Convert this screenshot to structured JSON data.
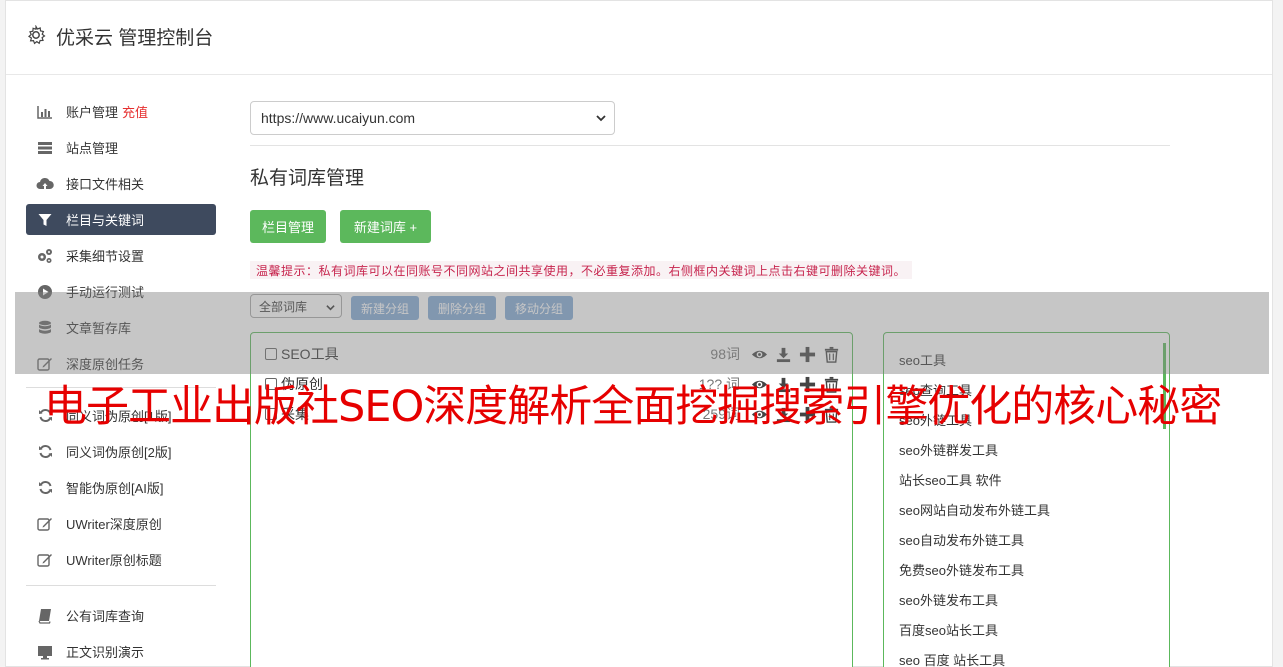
{
  "header": {
    "title": "优采云 管理控制台",
    "icon": "gear-icon"
  },
  "sidebar": {
    "items": [
      {
        "label": "账户管理",
        "badge": "充值",
        "icon": "bar-chart-icon"
      },
      {
        "label": "站点管理",
        "icon": "server-icon"
      },
      {
        "label": "接口文件相关",
        "icon": "cloud-upload-icon"
      },
      {
        "label": "栏目与关键词",
        "icon": "filter-icon",
        "active": true
      },
      {
        "label": "采集细节设置",
        "icon": "cogs-icon"
      },
      {
        "label": "手动运行测试",
        "icon": "play-circle-icon"
      },
      {
        "label": "文章暂存库",
        "icon": "database-icon"
      },
      {
        "label": "深度原创任务",
        "icon": "edit-icon"
      },
      {
        "label": "同义词伪原创[1版]",
        "icon": "refresh-icon"
      },
      {
        "label": "同义词伪原创[2版]",
        "icon": "refresh-icon"
      },
      {
        "label": "智能伪原创[AI版]",
        "icon": "refresh-icon"
      },
      {
        "label": "UWriter深度原创",
        "icon": "edit-icon"
      },
      {
        "label": "UWriter原创标题",
        "icon": "edit-icon"
      },
      {
        "label": "公有词库查询",
        "icon": "book-icon"
      },
      {
        "label": "正文识别演示",
        "icon": "monitor-icon"
      }
    ]
  },
  "main": {
    "site_select": "https://www.ucaiyun.com",
    "page_title": "私有词库管理",
    "btn_columns": "栏目管理",
    "btn_new_lib": "新建词库 +",
    "tip": "温馨提示：私有词库可以在同账号不同网站之间共享使用，不必重复添加。右侧框内关键词上点击右键可删除关键词。",
    "group_select": "全部词库",
    "btn_new_group": "新建分组",
    "btn_del_group": "删除分组",
    "btn_move_group": "移动分组",
    "libraries": [
      {
        "name": "SEO工具",
        "count": "98词"
      },
      {
        "name": "伪原创",
        "count": "1?? 词"
      },
      {
        "name": "采集",
        "count": "259词"
      }
    ],
    "keywords": [
      "seo工具",
      "seo查询工具",
      "seo外链工具",
      "seo外链群发工具",
      "站长seo工具 软件",
      "seo网站自动发布外链工具",
      "seo自动发布外链工具",
      "免费seo外链发布工具",
      "seo外链发布工具",
      "百度seo站长工具",
      "seo 百度 站长工具"
    ]
  },
  "overlay": {
    "text": "电子工业出版社SEO深度解析全面挖掘搜索引擎优化的核心秘密"
  },
  "colors": {
    "accent_green": "#5cb85c",
    "nav_active": "#3e4a5e",
    "danger_red": "#e63030",
    "overlay_red": "#e60000"
  }
}
